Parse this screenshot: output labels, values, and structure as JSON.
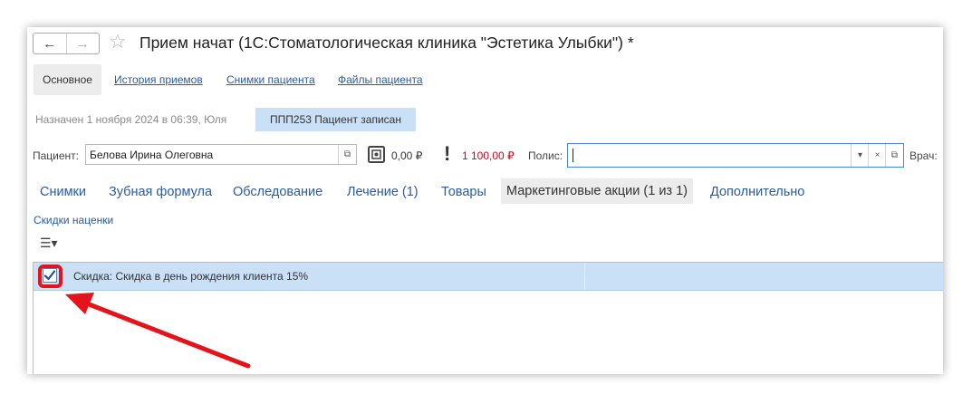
{
  "window": {
    "title": "Прием начат (1С:Стоматологическая клиника \"Эстетика Улыбки\") *",
    "back_icon": "←",
    "forward_icon": "→",
    "favorite_icon": "☆"
  },
  "top_tabs": {
    "main": "Основное",
    "links": [
      "История приемов",
      "Снимки пациента",
      "Файлы пациента"
    ]
  },
  "appointment": {
    "assigned_text": "Назначен 1 ноября 2024  в 06:39, Юля",
    "status_badge": "ППП253  Пациент записан"
  },
  "patient_bar": {
    "patient_label": "Пациент:",
    "patient_value": "Белова Ирина Олеговна",
    "open_icon": "⧉",
    "balance": "0,00 ₽",
    "debt_icon": "!",
    "debt": "1 100,00 ₽",
    "debt_color": "#d0021b",
    "policy_label": "Полис:",
    "policy_value": "",
    "dropdown_icon": "▾",
    "clear_icon": "×",
    "doctor_label": "Врач:"
  },
  "form_tabs": {
    "items": [
      "Снимки",
      "Зубная формула",
      "Обследование",
      "Лечение (1)",
      "Товары"
    ],
    "active": "Маркетинговые акции (1 из 1)",
    "last": "Дополнительно"
  },
  "discounts": {
    "section_link": "Скидки наценки",
    "menu_icon": "☰▾",
    "rows": [
      {
        "checked": true,
        "text": "Скидка: Скидка в день рождения клиента 15%"
      }
    ]
  },
  "annotation": {
    "color": "#e3141b"
  }
}
